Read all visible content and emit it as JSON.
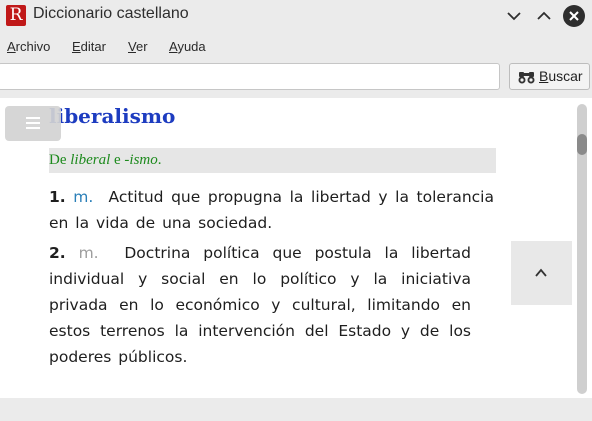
{
  "window": {
    "app_icon_letter": "R",
    "title": "Diccionario castellano"
  },
  "menu": {
    "items": [
      {
        "mnemonic": "A",
        "rest": "rchivo"
      },
      {
        "mnemonic": "E",
        "rest": "ditar"
      },
      {
        "mnemonic": "V",
        "rest": "er"
      },
      {
        "mnemonic": "A",
        "rest": "yuda"
      }
    ]
  },
  "search": {
    "query": "",
    "button_mnemonic": "B",
    "button_rest": "uscar"
  },
  "entry": {
    "headword": "liberalismo",
    "etymology": {
      "prefix": "De ",
      "word1": "liberal",
      "joiner": " e ",
      "word2": "-ismo",
      "suffix": "."
    },
    "senses": [
      {
        "number": "1.",
        "abbr": "m.",
        "text": "Actitud que propugna la libertad y la tolerancia en la vida de una sociedad."
      },
      {
        "number": "2.",
        "abbr": "m.",
        "text": "Doctrina política que postula la libertad individual y social en lo político y la iniciativa privada en lo económico y cultural, limitando en estos terrenos la intervención del Estado y de los poderes públicos."
      }
    ]
  },
  "icons": {
    "app": "app-icon",
    "minimize": "chevron-down-icon",
    "maximize": "chevron-up-icon",
    "close": "close-icon",
    "search": "binoculars-icon",
    "menu": "hamburger-icon",
    "scroll_top": "chevron-up-icon"
  },
  "colors": {
    "headword": "#1d3cc0",
    "etymology": "#1d8a1d",
    "abbr_sense1": "#2a7fb8",
    "abbr_sense2": "#9e9e9e",
    "app_icon": "#c01818"
  }
}
